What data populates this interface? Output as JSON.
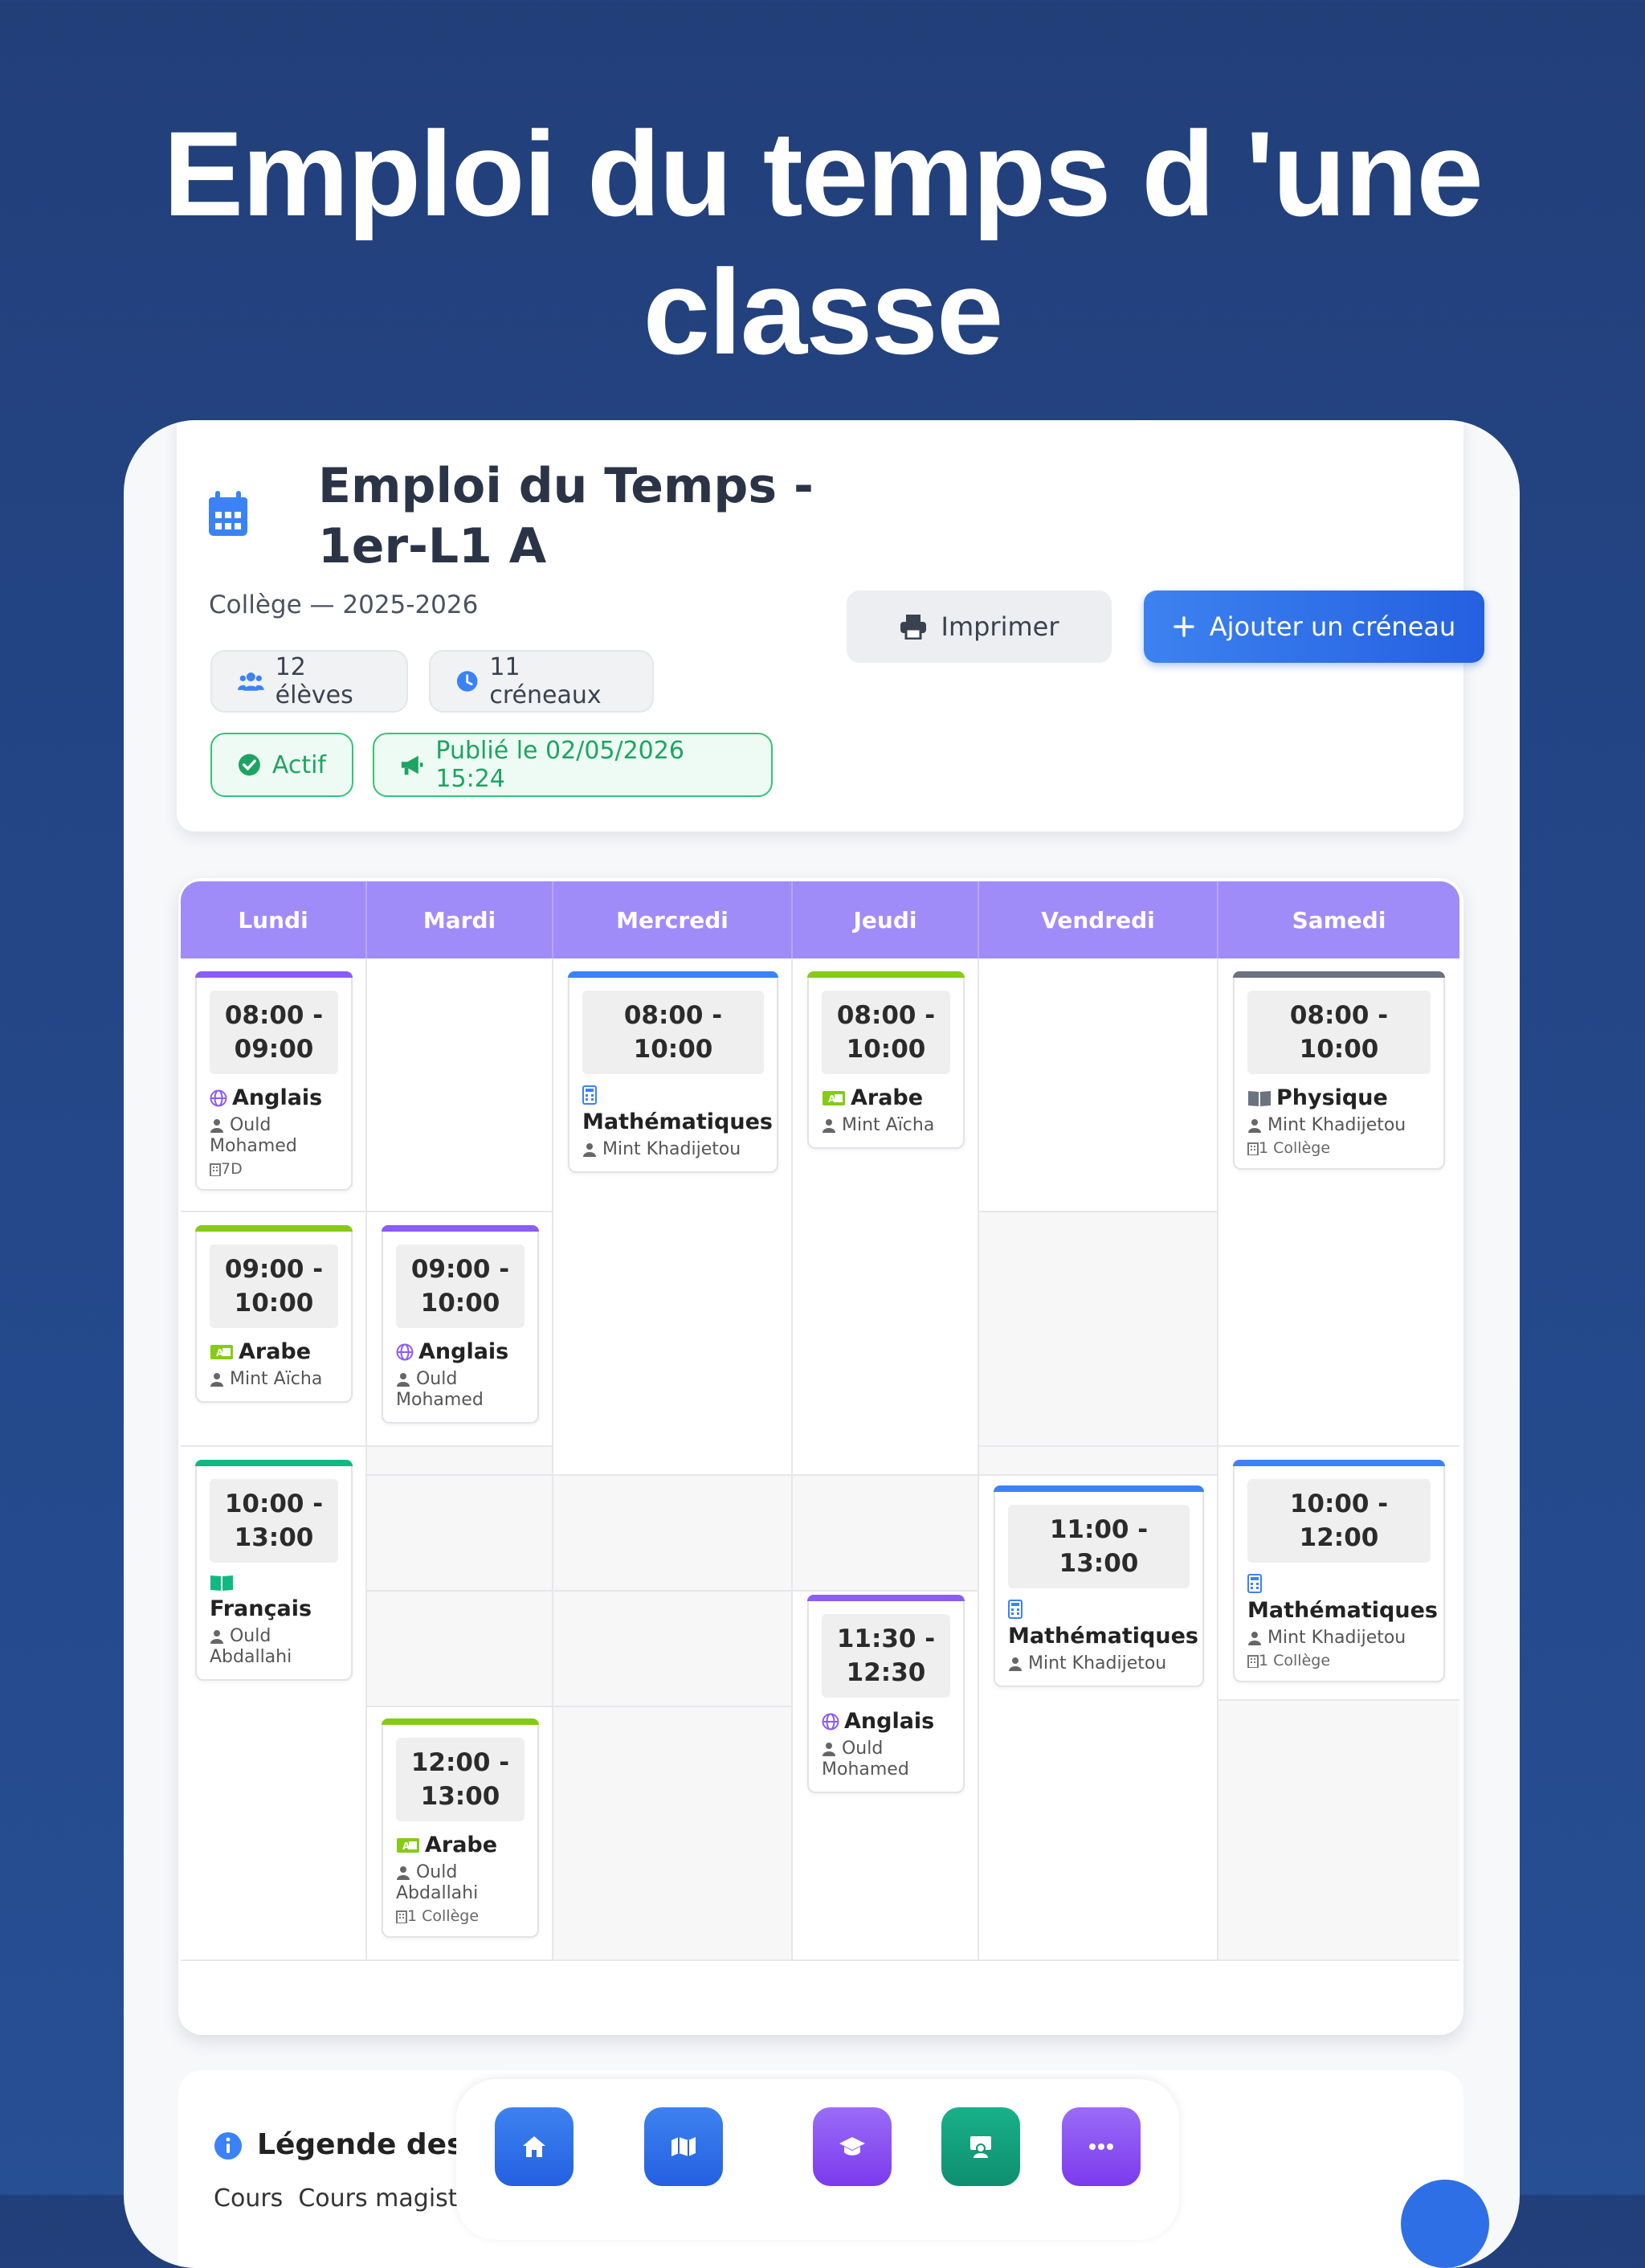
{
  "hero": {
    "title": "Emploi du temps d 'une classe"
  },
  "header": {
    "title": "Emploi du Temps - 1er-L1 A",
    "subtitle": "Collège — 2025-2026",
    "students_chip": "12 élèves",
    "slots_chip": "11 créneaux",
    "status_badge": "Actif",
    "published_badge": "Publié le 02/05/2026 15:24",
    "print_label": "Imprimer",
    "add_label": "Ajouter un créneau"
  },
  "timetable": {
    "days": [
      "Lundi",
      "Mardi",
      "Mercredi",
      "Jeudi",
      "Vendredi",
      "Samedi"
    ],
    "slots": [
      {
        "day": "Lundi",
        "time": "08:00 - 09:00",
        "subject": "Anglais",
        "teacher": "Ould Mohamed",
        "room": "7D",
        "color": "#8b5cf6",
        "icon": "globe-icon"
      },
      {
        "day": "Lundi",
        "time": "09:00 - 10:00",
        "subject": "Arabe",
        "teacher": "Mint Aïcha",
        "room": "",
        "color": "#84cc16",
        "icon": "language-icon"
      },
      {
        "day": "Lundi",
        "time": "10:00 - 13:00",
        "subject": "Français",
        "teacher": "Ould Abdallahi",
        "room": "",
        "color": "#10b981",
        "icon": "book-icon"
      },
      {
        "day": "Mardi",
        "time": "09:00 - 10:00",
        "subject": "Anglais",
        "teacher": "Ould Mohamed",
        "room": "",
        "color": "#8b5cf6",
        "icon": "globe-icon"
      },
      {
        "day": "Mardi",
        "time": "12:00 - 13:00",
        "subject": "Arabe",
        "teacher": "Ould Abdallahi",
        "room": "1 Collège",
        "color": "#84cc16",
        "icon": "language-icon"
      },
      {
        "day": "Mercredi",
        "time": "08:00 - 10:00",
        "subject": "Mathématiques",
        "teacher": "Mint Khadijetou",
        "room": "",
        "color": "#3b82f6",
        "icon": "calculator-icon"
      },
      {
        "day": "Jeudi",
        "time": "08:00 - 10:00",
        "subject": "Arabe",
        "teacher": "Mint Aïcha",
        "room": "",
        "color": "#84cc16",
        "icon": "language-icon"
      },
      {
        "day": "Jeudi",
        "time": "11:30 - 12:30",
        "subject": "Anglais",
        "teacher": "Ould Mohamed",
        "room": "",
        "color": "#8b5cf6",
        "icon": "globe-icon"
      },
      {
        "day": "Vendredi",
        "time": "11:00 - 13:00",
        "subject": "Mathématiques",
        "teacher": "Mint Khadijetou",
        "room": "",
        "color": "#3b82f6",
        "icon": "calculator-icon"
      },
      {
        "day": "Samedi",
        "time": "08:00 - 10:00",
        "subject": "Physique",
        "teacher": "Mint Khadijetou",
        "room": "1 Collège",
        "color": "#6b7280",
        "icon": "book-icon"
      },
      {
        "day": "Samedi",
        "time": "10:00 - 12:00",
        "subject": "Mathématiques",
        "teacher": "Mint Khadijetou",
        "room": "1 Collège",
        "color": "#3b82f6",
        "icon": "calculator-icon"
      }
    ]
  },
  "legend": {
    "title": "Légende des t",
    "row_label_1": "Cours",
    "row_label_2": "Cours magist"
  },
  "dock": {
    "items": [
      {
        "icon": "home-icon",
        "color": "#2f6be6"
      },
      {
        "icon": "map-icon",
        "color": "#2f6be6"
      },
      {
        "icon": "graduation-cap-icon",
        "color": "#8b5cf6"
      },
      {
        "icon": "teacher-icon",
        "color": "#10a37f"
      },
      {
        "icon": "more-icon",
        "color": "#8b5cf6"
      }
    ]
  },
  "colors": {
    "background": "#233f7c",
    "header_row": "#a08cf8",
    "primary": "#2f6be6",
    "success": "#1ea462"
  }
}
